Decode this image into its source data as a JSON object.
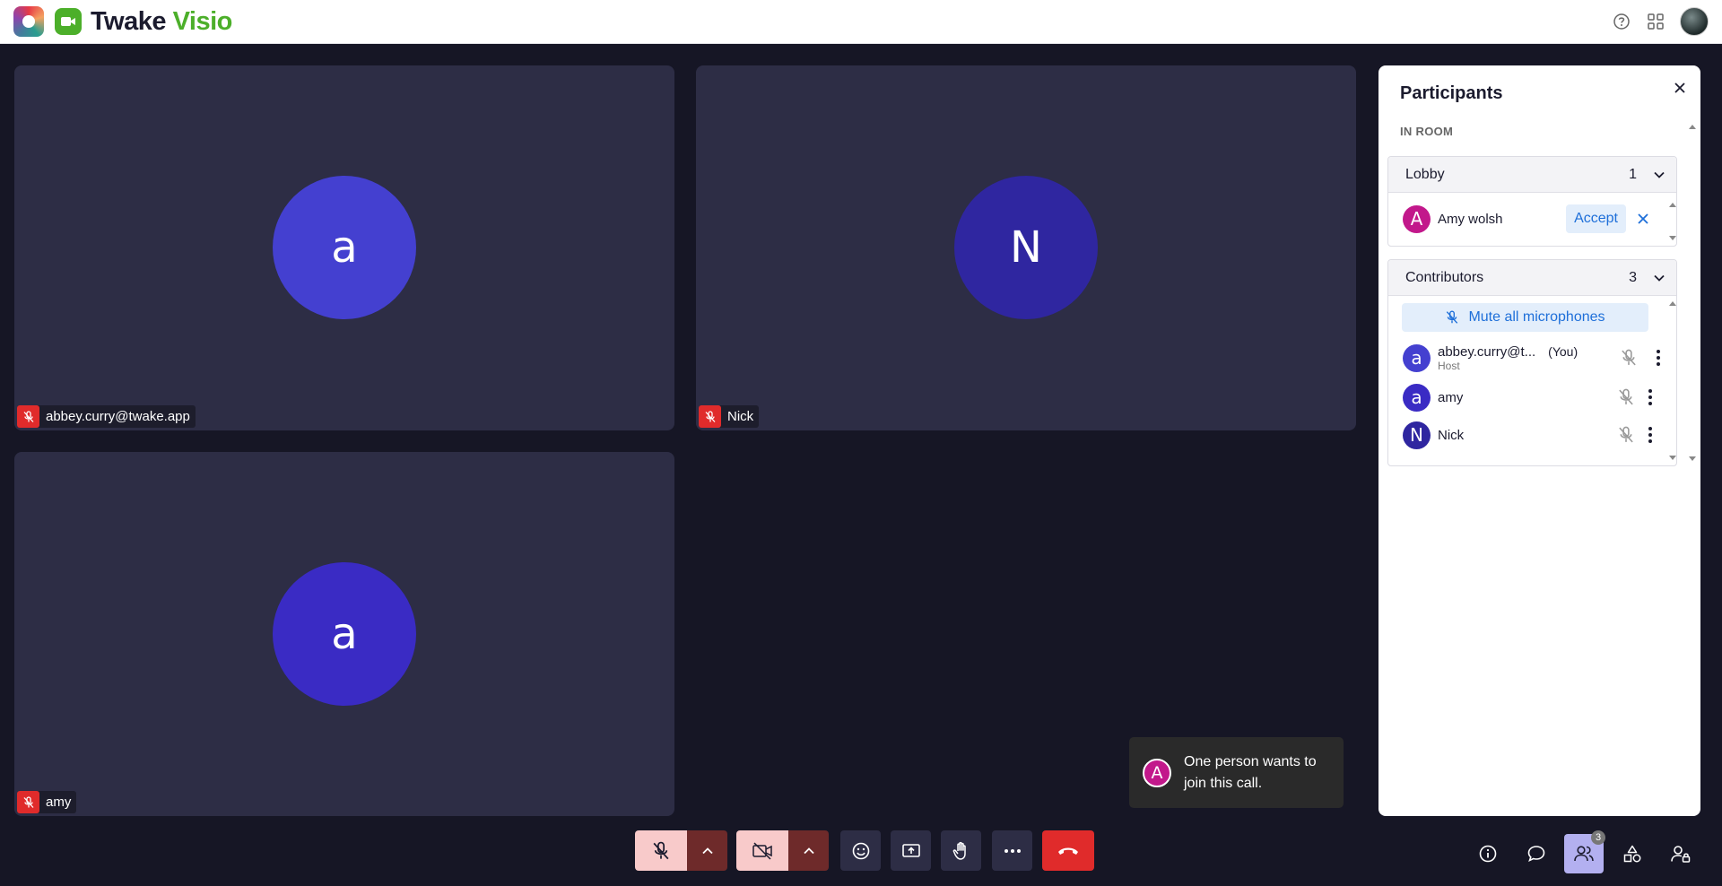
{
  "header": {
    "brand_part1": "Twake",
    "brand_part2": "Visio"
  },
  "tiles": [
    {
      "name": "abbey.curry@twake.app",
      "initial": "a",
      "color": "#4440d0"
    },
    {
      "name": "Nick",
      "initial": "N",
      "color": "#2f26a0"
    },
    {
      "name": "amy",
      "initial": "a",
      "color": "#3a2bc4"
    }
  ],
  "panel": {
    "title": "Participants",
    "subtitle": "IN ROOM",
    "lobby": {
      "label": "Lobby",
      "count": "1",
      "person": {
        "initial": "A",
        "name": "Amy wolsh",
        "color": "#c2188b"
      },
      "accept_label": "Accept"
    },
    "contributors": {
      "label": "Contributors",
      "count": "3",
      "mute_all_label": "Mute all microphones",
      "people": [
        {
          "initial": "a",
          "name": "abbey.curry@t...",
          "tag": "(You)",
          "role": "Host",
          "color": "#4440d0"
        },
        {
          "initial": "a",
          "name": "amy",
          "color": "#3a2bc4"
        },
        {
          "initial": "N",
          "name": "Nick",
          "color": "#2f26a0"
        }
      ]
    }
  },
  "toast": {
    "initial": "A",
    "message": "One person wants to join this call."
  },
  "participants_badge": "3",
  "colors": {
    "mic_off_red": "#e02b2b",
    "accent_blue": "#1e6fd9",
    "tile_bg": "#2d2d45",
    "stage_bg": "#161625",
    "brand_green": "#4caf2a"
  }
}
